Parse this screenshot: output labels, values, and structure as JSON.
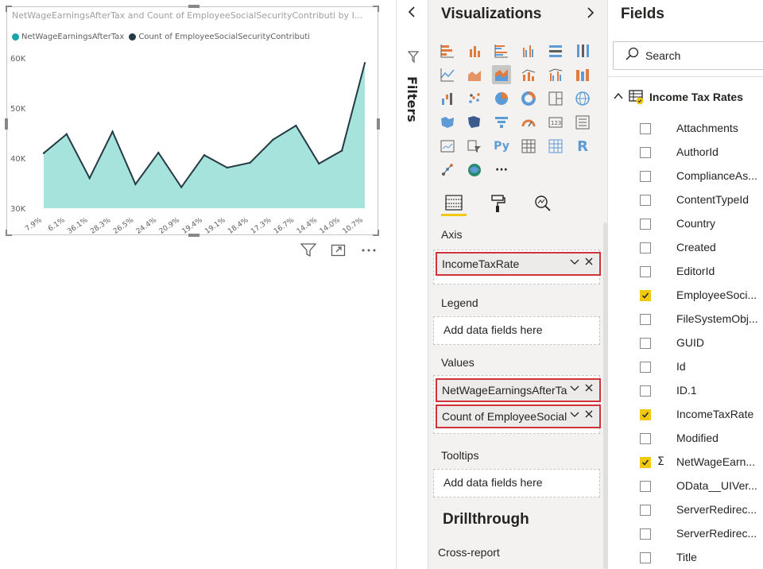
{
  "chart": {
    "title": "NetWageEarningsAfterTax and Count of EmployeeSocialSecurityContributi by I...",
    "legend": [
      {
        "label": "NetWageEarningsAfterTax",
        "color": "#118dff"
      },
      {
        "label": "Count of EmployeeSocialSecurityContributi",
        "color": "#12239e"
      }
    ]
  },
  "chart_data": {
    "type": "area",
    "categories": [
      "7.9%",
      "6.1%",
      "36.1%",
      "28.3%",
      "26.5%",
      "24.4%",
      "20.9%",
      "19.4%",
      "19.1%",
      "18.4%",
      "17.3%",
      "16.7%",
      "14.4%",
      "14.0%",
      "10.7%"
    ],
    "series": [
      {
        "name": "NetWageEarningsAfterTax",
        "values": [
          41000,
          44800,
          36000,
          45300,
          34800,
          41100,
          34200,
          40600,
          38100,
          39100,
          43700,
          46500,
          38900,
          41500,
          59000
        ],
        "color": "#a6e3dc",
        "stroke": "#243a44"
      }
    ],
    "yticks": [
      "30K",
      "40K",
      "50K",
      "60K"
    ],
    "ylim": [
      30000,
      60000
    ]
  },
  "visual_actions": {
    "filter_icon": "filter-icon",
    "focus_icon": "focus-mode-icon",
    "more_icon": "more-options-icon"
  },
  "filters": {
    "label": "Filters",
    "collapse_icon": "chevron-left-icon"
  },
  "visualizations": {
    "title": "Visualizations",
    "expand_icon": "chevron-right-icon",
    "more_label": "···",
    "tabs": [
      {
        "name": "fields-tab",
        "icon": "fields-well-icon"
      },
      {
        "name": "format-tab",
        "icon": "paint-roller-icon"
      },
      {
        "name": "analytics-tab",
        "icon": "analytics-magnifier-icon"
      }
    ],
    "axis_label": "Axis",
    "axis_field": "IncomeTaxRate",
    "legend_label": "Legend",
    "legend_placeholder": "Add data fields here",
    "values_label": "Values",
    "values_fields": [
      "NetWageEarningsAfterTax",
      "Count of EmployeeSocialSecurityContributi"
    ],
    "tooltips_label": "Tooltips",
    "tooltips_placeholder": "Add data fields here",
    "drillthrough_title": "Drillthrough",
    "cross_report_label": "Cross-report"
  },
  "fields": {
    "title": "Fields",
    "search_placeholder": "Search",
    "table_name": "Income Tax Rates",
    "items": [
      {
        "label": "Attachments",
        "checked": false,
        "sigma": false
      },
      {
        "label": "AuthorId",
        "checked": false,
        "sigma": false
      },
      {
        "label": "ComplianceAs...",
        "checked": false,
        "sigma": false
      },
      {
        "label": "ContentTypeId",
        "checked": false,
        "sigma": false
      },
      {
        "label": "Country",
        "checked": false,
        "sigma": false
      },
      {
        "label": "Created",
        "checked": false,
        "sigma": false
      },
      {
        "label": "EditorId",
        "checked": false,
        "sigma": false
      },
      {
        "label": "EmployeeSoci...",
        "checked": true,
        "sigma": false
      },
      {
        "label": "FileSystemObj...",
        "checked": false,
        "sigma": false
      },
      {
        "label": "GUID",
        "checked": false,
        "sigma": false
      },
      {
        "label": "Id",
        "checked": false,
        "sigma": false
      },
      {
        "label": "ID.1",
        "checked": false,
        "sigma": false
      },
      {
        "label": "IncomeTaxRate",
        "checked": true,
        "sigma": false
      },
      {
        "label": "Modified",
        "checked": false,
        "sigma": false
      },
      {
        "label": "NetWageEarn...",
        "checked": true,
        "sigma": true
      },
      {
        "label": "OData__UIVer...",
        "checked": false,
        "sigma": false
      },
      {
        "label": "ServerRedirec...",
        "checked": false,
        "sigma": false
      },
      {
        "label": "ServerRedirec...",
        "checked": false,
        "sigma": false
      },
      {
        "label": "Title",
        "checked": false,
        "sigma": false
      }
    ]
  },
  "colors": {
    "accent": "#f2c811",
    "highlight_border": "#d13438",
    "area_fill": "#a6e3dc",
    "line": "#243a44"
  }
}
